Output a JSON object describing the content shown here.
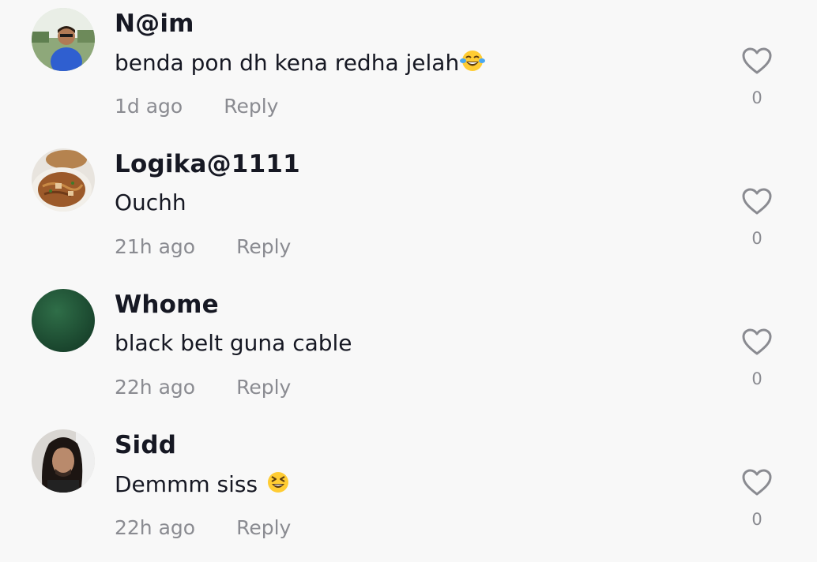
{
  "comments": [
    {
      "username": "N@im",
      "text": "benda pon dh kena redha jelah",
      "emoji": "laughing-tears",
      "time": "1d ago",
      "reply": "Reply",
      "likes": "0",
      "avatar": "photo-person-blue-shirt"
    },
    {
      "username": "Logika@1111",
      "text": "Ouchh",
      "emoji": "",
      "time": "21h ago",
      "reply": "Reply",
      "likes": "0",
      "avatar": "photo-fried-noodles"
    },
    {
      "username": "Whome",
      "text": "black belt guna cable",
      "emoji": "",
      "time": "22h ago",
      "reply": "Reply",
      "likes": "0",
      "avatar": "solid-dark-green"
    },
    {
      "username": "Sidd",
      "text": "Demmm siss ",
      "emoji": "squinting-grin",
      "time": "22h ago",
      "reply": "Reply",
      "likes": "0",
      "avatar": "photo-man-long-hair"
    }
  ],
  "colors": {
    "text": "#161823",
    "muted": "#8a8b91",
    "background": "#f8f8f8",
    "whome_avatar": "#1e4f33"
  }
}
